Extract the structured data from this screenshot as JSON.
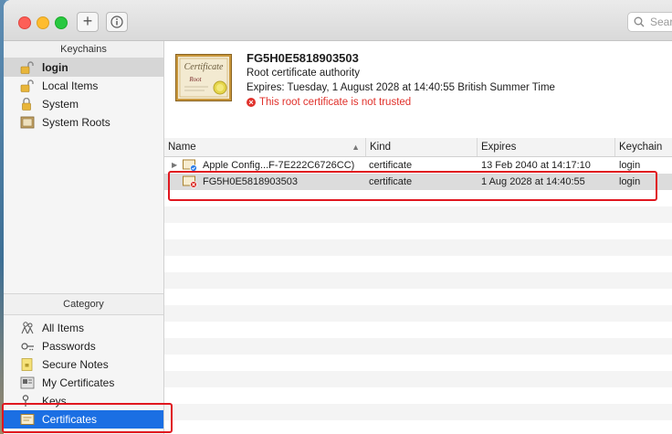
{
  "toolbar": {
    "add_label": "+",
    "info_label": "i",
    "search_placeholder": "Sear"
  },
  "sidebar": {
    "keychains_header": "Keychains",
    "keychains": [
      {
        "label": "login",
        "icon": "unlocked-padlock-icon"
      },
      {
        "label": "Local Items",
        "icon": "unlocked-padlock-icon"
      },
      {
        "label": "System",
        "icon": "locked-padlock-icon"
      },
      {
        "label": "System Roots",
        "icon": "cabinet-icon"
      }
    ],
    "category_header": "Category",
    "categories": [
      {
        "label": "All Items",
        "icon": "people-icon"
      },
      {
        "label": "Passwords",
        "icon": "key-dots-icon"
      },
      {
        "label": "Secure Notes",
        "icon": "note-icon"
      },
      {
        "label": "My Certificates",
        "icon": "id-card-icon"
      },
      {
        "label": "Keys",
        "icon": "key-icon"
      },
      {
        "label": "Certificates",
        "icon": "certificate-icon"
      }
    ]
  },
  "detail": {
    "cert_image_text_1": "Certificate",
    "cert_image_text_2": "Root",
    "title": "FG5H0E5818903503",
    "subtitle": "Root certificate authority",
    "expires": "Expires: Tuesday, 1 August 2028 at 14:40:55 British Summer Time",
    "warning": "This root certificate is not trusted"
  },
  "table": {
    "columns": {
      "name": "Name",
      "kind": "Kind",
      "expires": "Expires",
      "keychain": "Keychain"
    },
    "rows": [
      {
        "name": "Apple Config...F-7E222C6726CC)",
        "kind": "certificate",
        "expires": "13 Feb 2040 at 14:17:10",
        "keychain": "login"
      },
      {
        "name": "FG5H0E5818903503",
        "kind": "certificate",
        "expires": "1 Aug 2028 at 14:40:55",
        "keychain": "login"
      }
    ]
  },
  "colors": {
    "selection_blue": "#1b6fe3",
    "warning_red": "#e0312b",
    "highlight_red": "#e0171f"
  }
}
